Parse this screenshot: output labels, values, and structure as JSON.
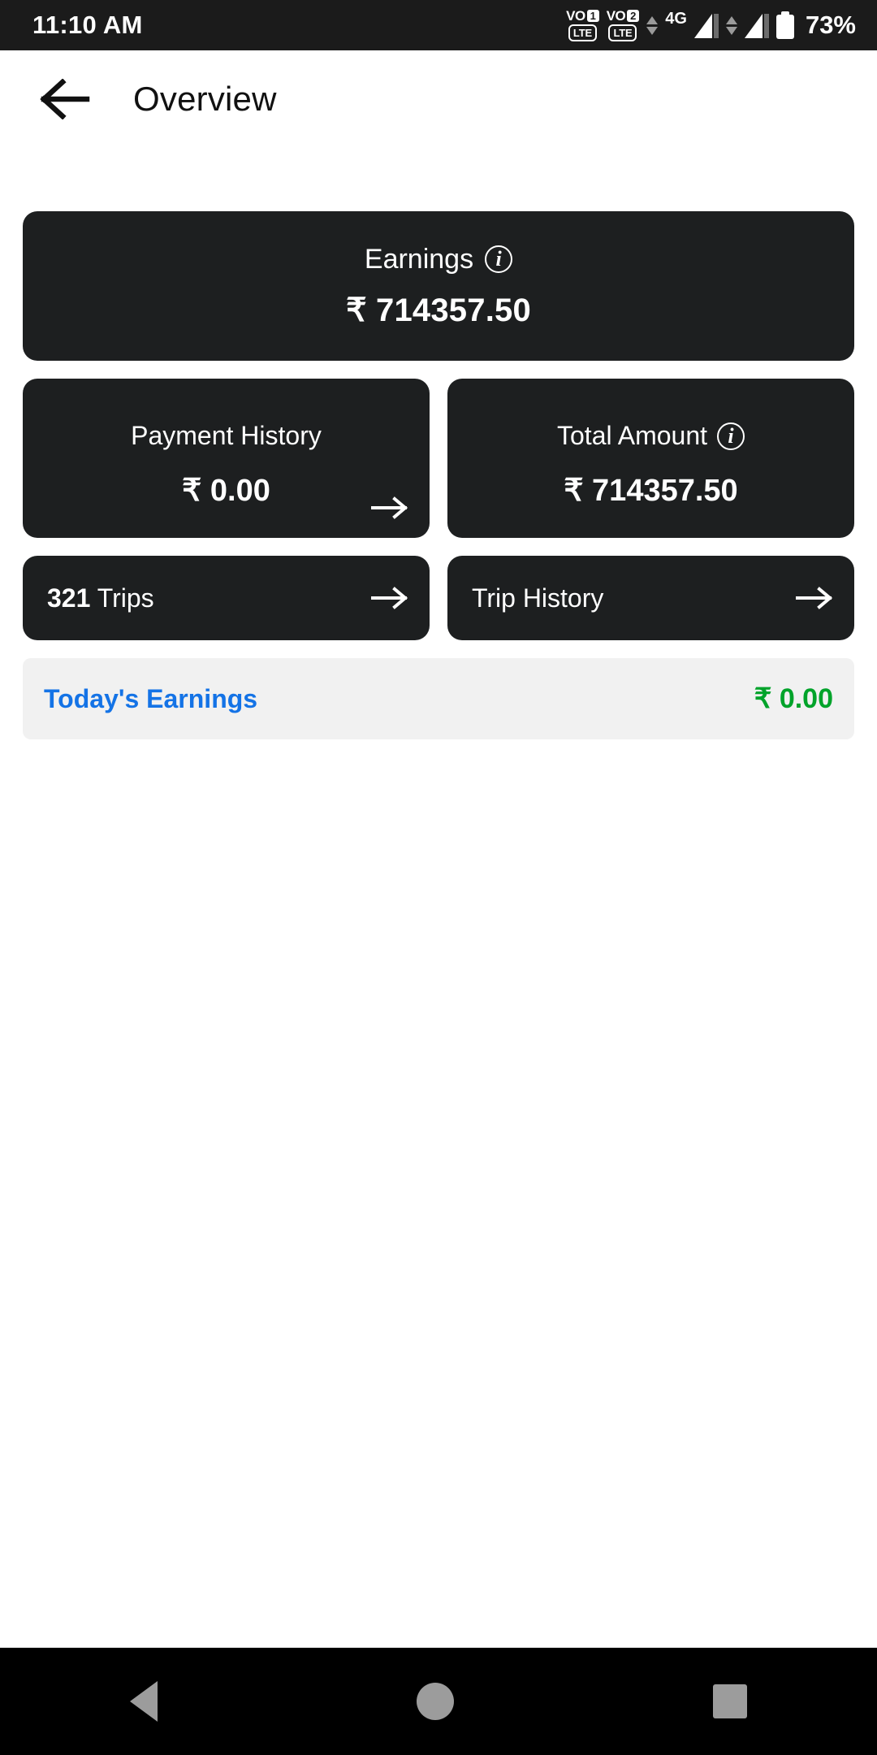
{
  "status_bar": {
    "time": "11:10 AM",
    "sim1_vo": "VO",
    "sim1_num": "1",
    "sim1_tech": "LTE",
    "sim2_vo": "VO",
    "sim2_num": "2",
    "sim2_tech": "LTE",
    "network": "4G",
    "battery_percent": "73%"
  },
  "app_bar": {
    "back_icon": "arrow-left-icon",
    "title": "Overview"
  },
  "earnings_card": {
    "label": "Earnings",
    "info_icon": "info-icon",
    "info_glyph": "i",
    "value": "₹ 714357.50"
  },
  "payment_history_card": {
    "label": "Payment History",
    "value": "₹ 0.00",
    "arrow_icon": "arrow-right-icon"
  },
  "total_amount_card": {
    "label": "Total Amount",
    "info_icon": "info-icon",
    "info_glyph": "i",
    "value": "₹ 714357.50"
  },
  "trips_card": {
    "count": "321",
    "label": "Trips",
    "arrow_icon": "arrow-right-icon"
  },
  "trip_history_card": {
    "label": "Trip History",
    "arrow_icon": "arrow-right-icon"
  },
  "today_row": {
    "label": "Today's Earnings",
    "value": "₹ 0.00"
  },
  "nav_bar": {
    "back_icon": "triangle-back-icon",
    "home_icon": "circle-home-icon",
    "recents_icon": "square-recents-icon"
  },
  "colors": {
    "card_dark": "#1d1f20",
    "status_bar": "#1b1b1b",
    "today_label": "#1473e6",
    "today_value": "#00a32a",
    "today_bg": "#f1f1f1",
    "page_bg": "#ffffff",
    "nav_bg": "#000000"
  }
}
